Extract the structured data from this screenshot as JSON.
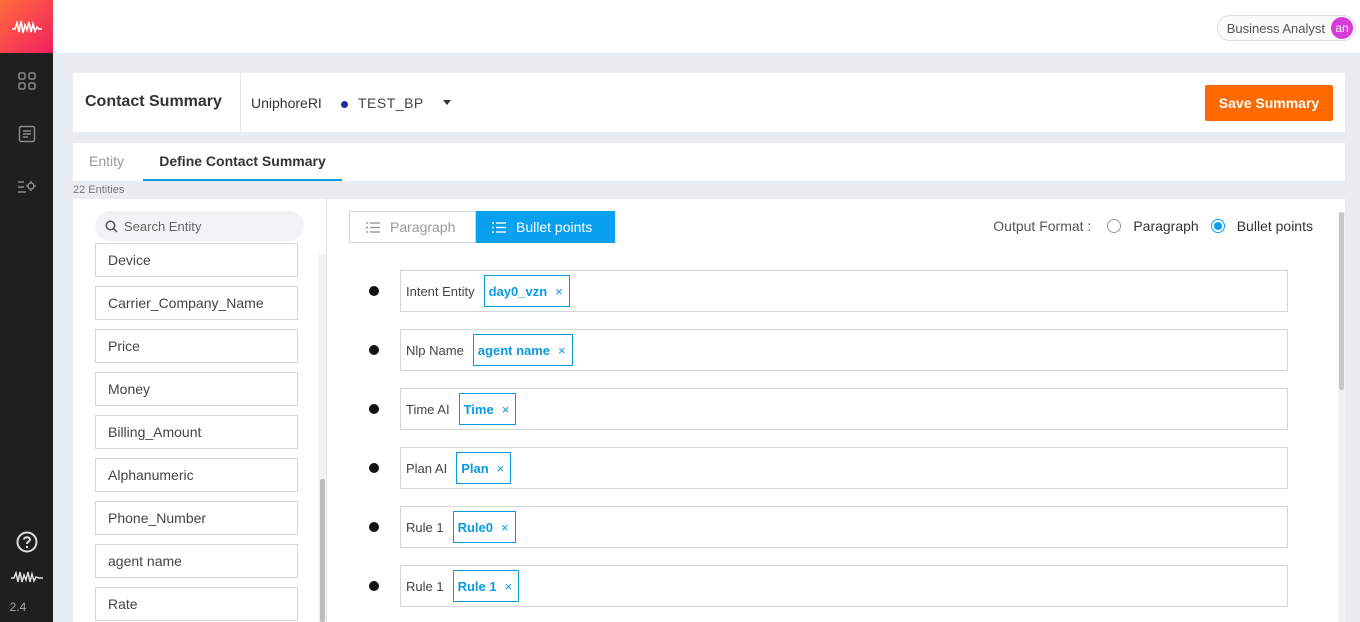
{
  "rail": {
    "icons": [
      "waveform-logo-icon",
      "grid-icon",
      "document-icon",
      "settings-list-icon",
      "help-icon",
      "waveform-icon"
    ],
    "version": "2.4"
  },
  "topbar": {
    "role": "Business Analyst",
    "avatar_initials": "an"
  },
  "header": {
    "title": "Contact Summary",
    "bot_name": "UniphoreRI",
    "version_name": "TEST_BP",
    "save_label": "Save Summary"
  },
  "tabs": {
    "entity": "Entity",
    "define": "Define Contact Summary"
  },
  "entity_count": "22 Entities",
  "search": {
    "placeholder": "Search Entity"
  },
  "entities": [
    "Device",
    "Carrier_Company_Name",
    "Price",
    "Money",
    "Billing_Amount",
    "Alphanumeric",
    "Phone_Number",
    "agent name",
    "Rate"
  ],
  "format_toggle": {
    "paragraph": "Paragraph",
    "bullets": "Bullet points"
  },
  "output_format": {
    "label": "Output Format :",
    "paragraph": "Paragraph",
    "bullets": "Bullet points",
    "selected": "bullets"
  },
  "rows": [
    {
      "label": "Intent Entity",
      "tag": "day0_vzn"
    },
    {
      "label": "Nlp Name",
      "tag": "agent name"
    },
    {
      "label": "Time AI",
      "tag": "Time"
    },
    {
      "label": "Plan AI",
      "tag": "Plan"
    },
    {
      "label": "Rule 1",
      "tag": "Rule0"
    },
    {
      "label": "Rule 1",
      "tag": "Rule 1"
    }
  ],
  "colors": {
    "accent": "#0aa0f0",
    "save_button": "#ff6a00",
    "rail": "#1f1f1f",
    "avatar": "#d63ad8",
    "status_dot": "#1e2fa8"
  }
}
